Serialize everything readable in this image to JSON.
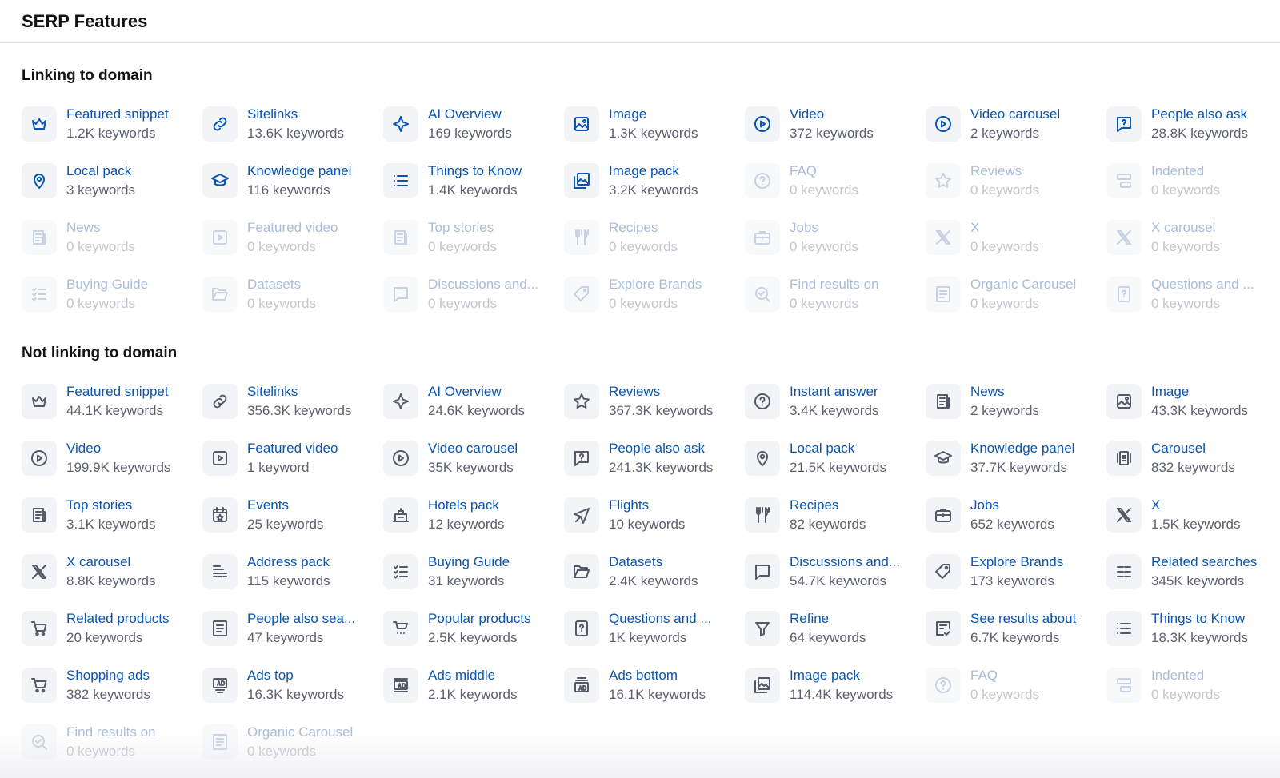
{
  "page": {
    "title": "SERP Features"
  },
  "colors": {
    "link": "#0a55b0",
    "count": "#5d6170",
    "muted_link": "#a9bdd9",
    "muted_count": "#c2c6cf",
    "icon_bg": "#f3f4f7"
  },
  "linking": {
    "title": "Linking to domain",
    "items": [
      {
        "name": "Featured snippet",
        "count": "1.2K keywords",
        "icon": "crown-icon",
        "active": true
      },
      {
        "name": "Sitelinks",
        "count": "13.6K keywords",
        "icon": "link-icon",
        "active": true
      },
      {
        "name": "AI Overview",
        "count": "169 keywords",
        "icon": "ai-sparkle-icon",
        "active": true
      },
      {
        "name": "Image",
        "count": "1.3K keywords",
        "icon": "image-icon",
        "active": true
      },
      {
        "name": "Video",
        "count": "372 keywords",
        "icon": "play-icon",
        "active": true
      },
      {
        "name": "Video carousel",
        "count": "2 keywords",
        "icon": "play-icon",
        "active": true
      },
      {
        "name": "People also ask",
        "count": "28.8K keywords",
        "icon": "question-bubble-icon",
        "active": true
      },
      {
        "name": "Local pack",
        "count": "3 keywords",
        "icon": "map-pin-icon",
        "active": true
      },
      {
        "name": "Knowledge panel",
        "count": "116 keywords",
        "icon": "graduation-cap-icon",
        "active": true
      },
      {
        "name": "Things to Know",
        "count": "1.4K keywords",
        "icon": "list-icon",
        "active": true
      },
      {
        "name": "Image pack",
        "count": "3.2K keywords",
        "icon": "image-stack-icon",
        "active": true
      },
      {
        "name": "FAQ",
        "count": "0 keywords",
        "icon": "question-circle-icon",
        "active": false
      },
      {
        "name": "Reviews",
        "count": "0 keywords",
        "icon": "star-icon",
        "active": false
      },
      {
        "name": "Indented",
        "count": "0 keywords",
        "icon": "indent-icon",
        "active": false
      },
      {
        "name": "News",
        "count": "0 keywords",
        "icon": "newspaper-icon",
        "active": false
      },
      {
        "name": "Featured video",
        "count": "0 keywords",
        "icon": "video-frame-icon",
        "active": false
      },
      {
        "name": "Top stories",
        "count": "0 keywords",
        "icon": "newspaper-icon",
        "active": false
      },
      {
        "name": "Recipes",
        "count": "0 keywords",
        "icon": "fork-knife-icon",
        "active": false
      },
      {
        "name": "Jobs",
        "count": "0 keywords",
        "icon": "briefcase-icon",
        "active": false
      },
      {
        "name": "X",
        "count": "0 keywords",
        "icon": "x-logo-icon",
        "active": false
      },
      {
        "name": "X carousel",
        "count": "0 keywords",
        "icon": "x-logo-icon",
        "active": false
      },
      {
        "name": "Buying Guide",
        "count": "0 keywords",
        "icon": "checklist-icon",
        "active": false
      },
      {
        "name": "Datasets",
        "count": "0 keywords",
        "icon": "folder-open-icon",
        "active": false
      },
      {
        "name": "Discussions and...",
        "count": "0 keywords",
        "icon": "chat-bubble-icon",
        "active": false
      },
      {
        "name": "Explore Brands",
        "count": "0 keywords",
        "icon": "tag-icon",
        "active": false
      },
      {
        "name": "Find results on",
        "count": "0 keywords",
        "icon": "search-check-icon",
        "active": false
      },
      {
        "name": "Organic Carousel",
        "count": "0 keywords",
        "icon": "document-lines-icon",
        "active": false
      },
      {
        "name": "Questions and ...",
        "count": "0 keywords",
        "icon": "question-document-icon",
        "active": false
      }
    ]
  },
  "not_linking": {
    "title": "Not linking to domain",
    "items": [
      {
        "name": "Featured snippet",
        "count": "44.1K keywords",
        "icon": "crown-icon",
        "active": true
      },
      {
        "name": "Sitelinks",
        "count": "356.3K keywords",
        "icon": "link-icon",
        "active": true
      },
      {
        "name": "AI Overview",
        "count": "24.6K keywords",
        "icon": "ai-sparkle-icon",
        "active": true
      },
      {
        "name": "Reviews",
        "count": "367.3K keywords",
        "icon": "star-icon",
        "active": true
      },
      {
        "name": "Instant answer",
        "count": "3.4K keywords",
        "icon": "question-circle-icon",
        "active": true
      },
      {
        "name": "News",
        "count": "2 keywords",
        "icon": "newspaper-icon",
        "active": true
      },
      {
        "name": "Image",
        "count": "43.3K keywords",
        "icon": "image-icon",
        "active": true
      },
      {
        "name": "Video",
        "count": "199.9K keywords",
        "icon": "play-icon",
        "active": true
      },
      {
        "name": "Featured video",
        "count": "1 keyword",
        "icon": "video-frame-icon",
        "active": true
      },
      {
        "name": "Video carousel",
        "count": "35K keywords",
        "icon": "play-icon",
        "active": true
      },
      {
        "name": "People also ask",
        "count": "241.3K keywords",
        "icon": "question-bubble-icon",
        "active": true
      },
      {
        "name": "Local pack",
        "count": "21.5K keywords",
        "icon": "map-pin-icon",
        "active": true
      },
      {
        "name": "Knowledge panel",
        "count": "37.7K keywords",
        "icon": "graduation-cap-icon",
        "active": true
      },
      {
        "name": "Carousel",
        "count": "832 keywords",
        "icon": "carousel-icon",
        "active": true
      },
      {
        "name": "Top stories",
        "count": "3.1K keywords",
        "icon": "newspaper-icon",
        "active": true
      },
      {
        "name": "Events",
        "count": "25 keywords",
        "icon": "calendar-star-icon",
        "active": true
      },
      {
        "name": "Hotels pack",
        "count": "12 keywords",
        "icon": "hotel-icon",
        "active": true
      },
      {
        "name": "Flights",
        "count": "10 keywords",
        "icon": "plane-icon",
        "active": true
      },
      {
        "name": "Recipes",
        "count": "82 keywords",
        "icon": "fork-knife-icon",
        "active": true
      },
      {
        "name": "Jobs",
        "count": "652 keywords",
        "icon": "briefcase-icon",
        "active": true
      },
      {
        "name": "X",
        "count": "1.5K keywords",
        "icon": "x-logo-icon",
        "active": true
      },
      {
        "name": "X carousel",
        "count": "8.8K keywords",
        "icon": "x-logo-icon",
        "active": true
      },
      {
        "name": "Address pack",
        "count": "115 keywords",
        "icon": "address-list-icon",
        "active": true
      },
      {
        "name": "Buying Guide",
        "count": "31 keywords",
        "icon": "checklist-icon",
        "active": true
      },
      {
        "name": "Datasets",
        "count": "2.4K keywords",
        "icon": "folder-open-icon",
        "active": true
      },
      {
        "name": "Discussions and...",
        "count": "54.7K keywords",
        "icon": "chat-bubble-icon",
        "active": true
      },
      {
        "name": "Explore Brands",
        "count": "173 keywords",
        "icon": "tag-icon",
        "active": true
      },
      {
        "name": "Related searches",
        "count": "345K keywords",
        "icon": "lines-grid-icon",
        "active": true
      },
      {
        "name": "Related products",
        "count": "20 keywords",
        "icon": "cart-icon",
        "active": true
      },
      {
        "name": "People also sea...",
        "count": "47 keywords",
        "icon": "document-lines-icon",
        "active": true
      },
      {
        "name": "Popular products",
        "count": "2.5K keywords",
        "icon": "cart-stars-icon",
        "active": true
      },
      {
        "name": "Questions and ...",
        "count": "1K keywords",
        "icon": "question-document-icon",
        "active": true
      },
      {
        "name": "Refine",
        "count": "64 keywords",
        "icon": "filter-icon",
        "active": true
      },
      {
        "name": "See results about",
        "count": "6.7K keywords",
        "icon": "document-check-icon",
        "active": true
      },
      {
        "name": "Things to Know",
        "count": "18.3K keywords",
        "icon": "list-icon",
        "active": true
      },
      {
        "name": "Shopping ads",
        "count": "382 keywords",
        "icon": "cart-icon",
        "active": true
      },
      {
        "name": "Ads top",
        "count": "16.3K keywords",
        "icon": "ad-top-icon",
        "active": true
      },
      {
        "name": "Ads middle",
        "count": "2.1K keywords",
        "icon": "ad-middle-icon",
        "active": true
      },
      {
        "name": "Ads bottom",
        "count": "16.1K keywords",
        "icon": "ad-bottom-icon",
        "active": true
      },
      {
        "name": "Image pack",
        "count": "114.4K keywords",
        "icon": "image-stack-icon",
        "active": true
      },
      {
        "name": "FAQ",
        "count": "0 keywords",
        "icon": "question-circle-icon",
        "active": false
      },
      {
        "name": "Indented",
        "count": "0 keywords",
        "icon": "indent-icon",
        "active": false
      },
      {
        "name": "Find results on",
        "count": "0 keywords",
        "icon": "search-check-icon",
        "active": false
      },
      {
        "name": "Organic Carousel",
        "count": "0 keywords",
        "icon": "document-lines-icon",
        "active": false
      }
    ]
  }
}
